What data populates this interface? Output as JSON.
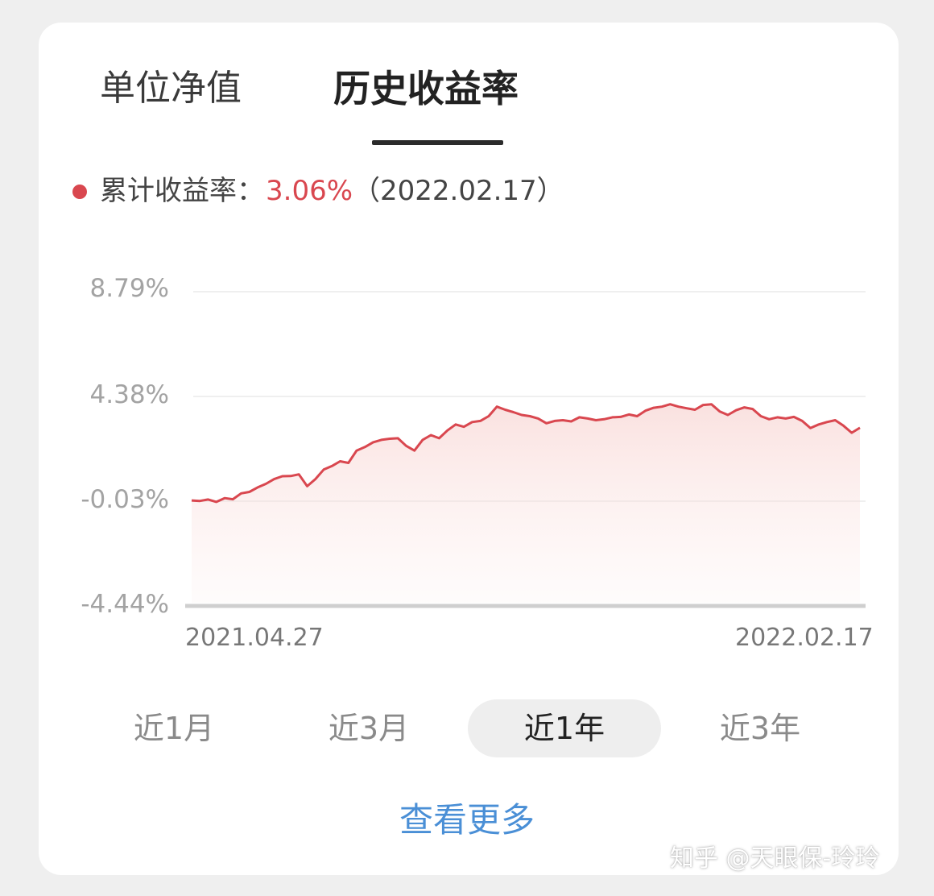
{
  "tabs": [
    {
      "label": "单位净值",
      "active": false
    },
    {
      "label": "历史收益率",
      "active": true
    }
  ],
  "legend": {
    "label": "累计收益率：",
    "value": "3.06%",
    "date": "（2022.02.17）",
    "color": "#d9474f"
  },
  "chart_data": {
    "type": "area",
    "title": "",
    "xlabel": "",
    "ylabel": "",
    "x_start": "2021.04.27",
    "x_end": "2022.02.17",
    "yticks": [
      "8.79%",
      "4.38%",
      "-0.03%",
      "-4.44%"
    ],
    "ytick_values": [
      8.79,
      4.38,
      -0.03,
      -4.44
    ],
    "ylim": [
      -4.44,
      8.79
    ],
    "grid": true,
    "series": [
      {
        "values": [
          0.0,
          -0.02,
          0.04,
          -0.06,
          0.1,
          0.05,
          0.3,
          0.36,
          0.55,
          0.7,
          0.9,
          1.02,
          1.03,
          1.1,
          0.6,
          0.9,
          1.3,
          1.45,
          1.65,
          1.58,
          2.1,
          2.25,
          2.45,
          2.55,
          2.6,
          2.62,
          2.3,
          2.1,
          2.55,
          2.75,
          2.62,
          2.95,
          3.2,
          3.1,
          3.3,
          3.35,
          3.55,
          3.95,
          3.82,
          3.72,
          3.6,
          3.55,
          3.45,
          3.25,
          3.35,
          3.38,
          3.33,
          3.5,
          3.45,
          3.38,
          3.42,
          3.5,
          3.52,
          3.62,
          3.55,
          3.78,
          3.9,
          3.95,
          4.05,
          3.95,
          3.88,
          3.82,
          4.02,
          4.05,
          3.75,
          3.6,
          3.8,
          3.92,
          3.85,
          3.55,
          3.42,
          3.5,
          3.45,
          3.52,
          3.35,
          3.05,
          3.2,
          3.3,
          3.38,
          3.15,
          2.85,
          3.06
        ]
      }
    ]
  },
  "range_buttons": [
    {
      "label": "近1月",
      "active": false
    },
    {
      "label": "近3月",
      "active": false
    },
    {
      "label": "近1年",
      "active": true
    },
    {
      "label": "近3年",
      "active": false
    }
  ],
  "more_link": "查看更多",
  "watermark": "知乎 @天眼保-玲玲"
}
